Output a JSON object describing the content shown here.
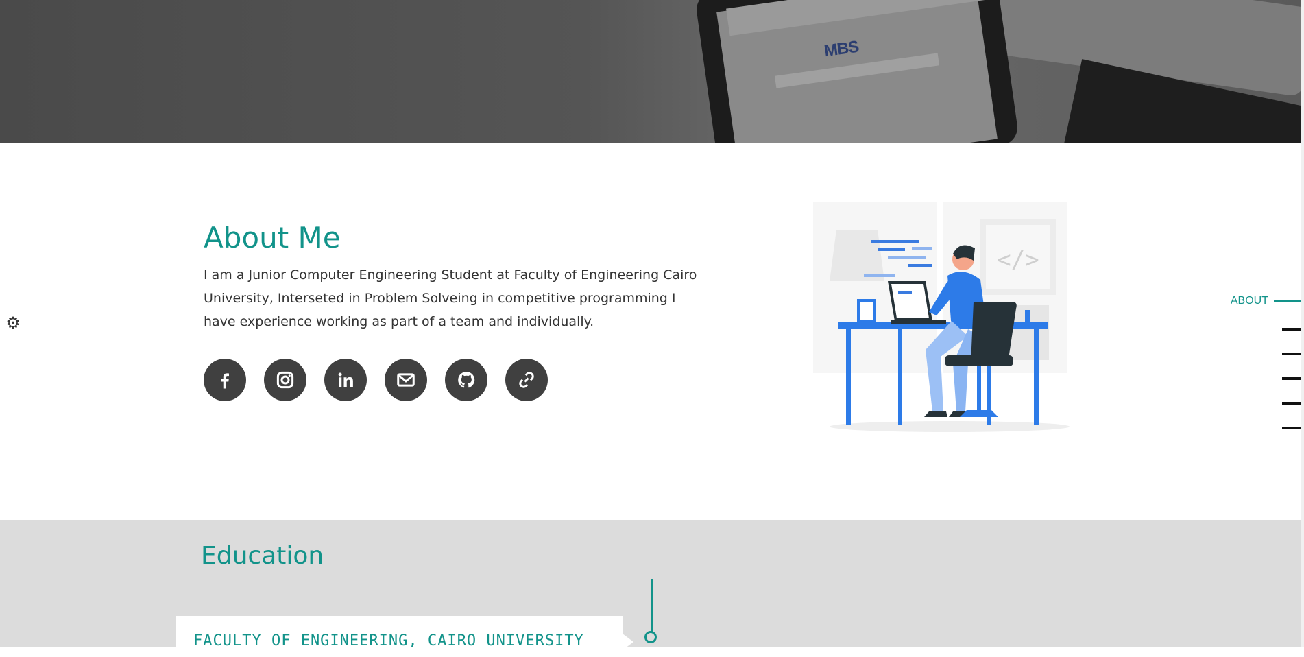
{
  "hero": {
    "image_description": "grayscale-laptop-keyboard",
    "screen_logo": "MBS"
  },
  "settings": {
    "icon": "gear-icon"
  },
  "about": {
    "title": "About Me",
    "text": "I am a Junior Computer Engineering Student at Faculty of Engineering Cairo University, Interseted in Problem Solveing in competitive programming I have experience working as part of a team and individually.",
    "socials": [
      {
        "name": "facebook",
        "icon": "facebook-icon"
      },
      {
        "name": "instagram",
        "icon": "instagram-icon"
      },
      {
        "name": "linkedin",
        "icon": "linkedin-icon"
      },
      {
        "name": "email",
        "icon": "mail-icon"
      },
      {
        "name": "github",
        "icon": "github-icon"
      },
      {
        "name": "link",
        "icon": "link-icon"
      }
    ],
    "illustration_code_tag": "</>"
  },
  "side_nav": {
    "active_label": "ABOUT",
    "item_count": 5
  },
  "education": {
    "title": "Education",
    "card_title": "FACULTY OF ENGINEERING, CAIRO UNIVERSITY"
  },
  "colors": {
    "accent": "#12938a",
    "icon_bg": "#404040",
    "section_gray": "#dcdcdc"
  }
}
